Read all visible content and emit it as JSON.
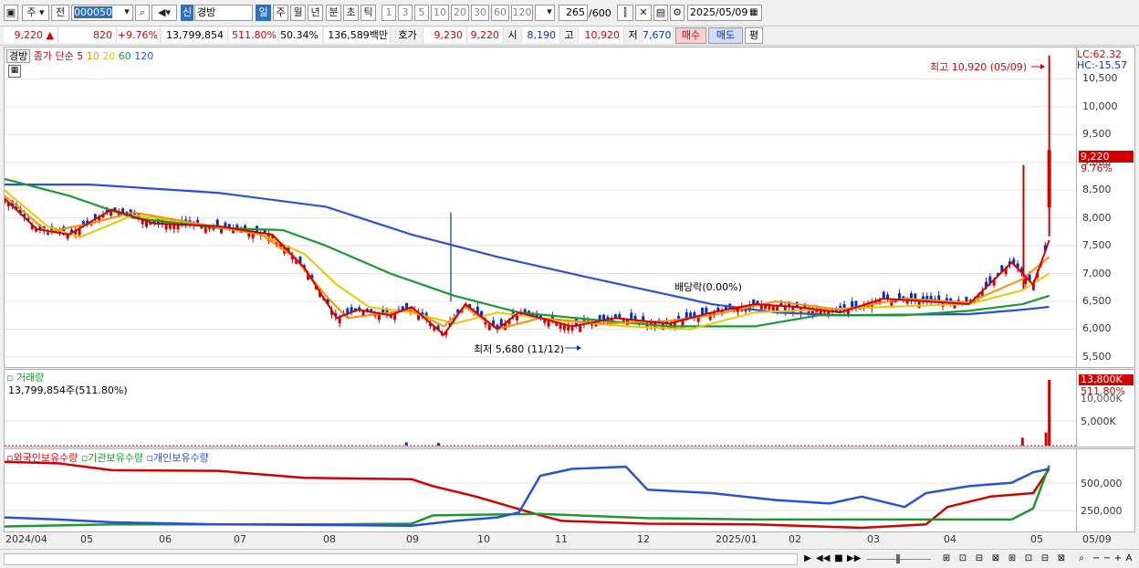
{
  "toolbar": {
    "market": "주",
    "prefix": "전",
    "code": "000050",
    "badge": "신",
    "name": "경방",
    "periods": [
      "일",
      "주",
      "월",
      "년",
      "분",
      "초",
      "틱"
    ],
    "active_period": "일",
    "intervals": [
      "1",
      "3",
      "5",
      "10",
      "20",
      "30",
      "60",
      "120"
    ],
    "count": "265",
    "total": "/600",
    "date": "2025/05/09"
  },
  "quote": {
    "price": "9,220",
    "arrow": "▲",
    "change": "820",
    "change_pct": "+9.76%",
    "volume": "13,799,854",
    "volume_pct": "511.80%",
    "turnover": "50.34%",
    "amount": "136,589백만",
    "bid_label": "호가",
    "bid1": "9,230",
    "bid2": "9,220",
    "open_label": "시",
    "open": "8,190",
    "high_label": "고",
    "high": "10,920",
    "low_label": "저",
    "low": "7,670",
    "buy": "매수",
    "sell": "매도",
    "avg": "평"
  },
  "price_pane": {
    "tag": "경방",
    "ma_label": "종가 단순",
    "ma_periods": [
      "5",
      "10",
      "20",
      "60",
      "120"
    ],
    "ma_colors": [
      "#d40000",
      "#ff8c00",
      "#e6c800",
      "#1a9a30",
      "#2850d8"
    ],
    "lc": "LC:62.32",
    "hc": "HC:-15.57",
    "high_note": "최고 10,920 (05/09)",
    "low_note": "최저 5,680 (11/12)",
    "dividend_note": "배당락(0.00%)",
    "y_ticks": [
      "10,500",
      "10,000",
      "9,500",
      "9,000",
      "8,500",
      "8,000",
      "7,500",
      "7,000",
      "6,500",
      "6,000",
      "5,500"
    ],
    "last_price": "9,220",
    "last_pct": "9.76%"
  },
  "volume_pane": {
    "title": "거래량",
    "value": "13,799,854주(511.80%)",
    "y_ticks": [
      "10,000K",
      "5,000K"
    ],
    "last_value": "13,800K",
    "last_pct": "511.80%"
  },
  "holding_pane": {
    "series": [
      "외국인보유수량",
      "기관보유수량",
      "개인보유수량"
    ],
    "colors": [
      "#d40000",
      "#1a9a30",
      "#2850d8"
    ],
    "y_ticks": [
      "500,000",
      "250,000"
    ]
  },
  "x_ticks": [
    "2024/04",
    "05",
    "06",
    "07",
    "08",
    "09",
    "10",
    "11",
    "12",
    "2025/01",
    "02",
    "03",
    "04",
    "05",
    "05/09"
  ],
  "chart_data": {
    "type": "candlestick",
    "price_range": [
      5400,
      10900
    ],
    "ma": {
      "ma120": [
        [
          0,
          8600
        ],
        [
          0.08,
          8600
        ],
        [
          0.2,
          8450
        ],
        [
          0.3,
          8200
        ],
        [
          0.38,
          7700
        ],
        [
          0.46,
          7300
        ],
        [
          0.54,
          6950
        ],
        [
          0.6,
          6700
        ],
        [
          0.66,
          6450
        ],
        [
          0.72,
          6300
        ],
        [
          0.78,
          6250
        ],
        [
          0.9,
          6270
        ],
        [
          0.95,
          6350
        ],
        [
          0.975,
          6400
        ]
      ],
      "ma60": [
        [
          0,
          8700
        ],
        [
          0.06,
          8400
        ],
        [
          0.12,
          8000
        ],
        [
          0.2,
          7820
        ],
        [
          0.26,
          7780
        ],
        [
          0.3,
          7500
        ],
        [
          0.36,
          7000
        ],
        [
          0.42,
          6600
        ],
        [
          0.48,
          6300
        ],
        [
          0.56,
          6150
        ],
        [
          0.62,
          6050
        ],
        [
          0.7,
          6050
        ],
        [
          0.76,
          6250
        ],
        [
          0.84,
          6250
        ],
        [
          0.9,
          6330
        ],
        [
          0.95,
          6450
        ],
        [
          0.975,
          6600
        ]
      ],
      "ma20": [
        [
          0,
          8500
        ],
        [
          0.04,
          7850
        ],
        [
          0.07,
          7650
        ],
        [
          0.12,
          8050
        ],
        [
          0.18,
          7900
        ],
        [
          0.24,
          7700
        ],
        [
          0.28,
          7350
        ],
        [
          0.31,
          6800
        ],
        [
          0.34,
          6400
        ],
        [
          0.38,
          6300
        ],
        [
          0.42,
          6100
        ],
        [
          0.46,
          6300
        ],
        [
          0.52,
          6150
        ],
        [
          0.58,
          6050
        ],
        [
          0.64,
          6000
        ],
        [
          0.7,
          6300
        ],
        [
          0.76,
          6350
        ],
        [
          0.82,
          6400
        ],
        [
          0.9,
          6450
        ],
        [
          0.95,
          6700
        ],
        [
          0.975,
          7000
        ]
      ],
      "ma10": [
        [
          0,
          8400
        ],
        [
          0.04,
          7750
        ],
        [
          0.08,
          7900
        ],
        [
          0.12,
          8100
        ],
        [
          0.18,
          7900
        ],
        [
          0.24,
          7700
        ],
        [
          0.27,
          7300
        ],
        [
          0.3,
          6600
        ],
        [
          0.32,
          6200
        ],
        [
          0.36,
          6300
        ],
        [
          0.38,
          6350
        ],
        [
          0.41,
          6050
        ],
        [
          0.43,
          6400
        ],
        [
          0.46,
          6000
        ],
        [
          0.5,
          6200
        ],
        [
          0.56,
          6100
        ],
        [
          0.62,
          6150
        ],
        [
          0.66,
          6250
        ],
        [
          0.72,
          6500
        ],
        [
          0.78,
          6350
        ],
        [
          0.84,
          6550
        ],
        [
          0.9,
          6480
        ],
        [
          0.95,
          6900
        ],
        [
          0.975,
          7300
        ]
      ],
      "ma5": [
        [
          0,
          8350
        ],
        [
          0.03,
          7800
        ],
        [
          0.06,
          7700
        ],
        [
          0.1,
          8150
        ],
        [
          0.14,
          7900
        ],
        [
          0.2,
          7850
        ],
        [
          0.25,
          7700
        ],
        [
          0.28,
          7100
        ],
        [
          0.31,
          6200
        ],
        [
          0.33,
          6350
        ],
        [
          0.36,
          6250
        ],
        [
          0.38,
          6400
        ],
        [
          0.41,
          5900
        ],
        [
          0.43,
          6450
        ],
        [
          0.46,
          6000
        ],
        [
          0.48,
          6300
        ],
        [
          0.53,
          6050
        ],
        [
          0.57,
          6200
        ],
        [
          0.62,
          6100
        ],
        [
          0.66,
          6300
        ],
        [
          0.7,
          6450
        ],
        [
          0.74,
          6400
        ],
        [
          0.78,
          6300
        ],
        [
          0.82,
          6550
        ],
        [
          0.86,
          6500
        ],
        [
          0.9,
          6450
        ],
        [
          0.94,
          7200
        ],
        [
          0.96,
          6800
        ],
        [
          0.975,
          7600
        ]
      ]
    },
    "volume_spikes": [
      [
        0.375,
        0.05
      ],
      [
        0.405,
        0.04
      ],
      [
        0.95,
        0.12
      ],
      [
        0.972,
        0.2
      ],
      [
        0.975,
        1.0
      ]
    ],
    "holdings": {
      "foreign": [
        [
          0,
          0.95
        ],
        [
          0.05,
          0.93
        ],
        [
          0.1,
          0.83
        ],
        [
          0.2,
          0.82
        ],
        [
          0.28,
          0.72
        ],
        [
          0.38,
          0.7
        ],
        [
          0.4,
          0.6
        ],
        [
          0.44,
          0.45
        ],
        [
          0.5,
          0.18
        ],
        [
          0.52,
          0.1
        ],
        [
          0.6,
          0.06
        ],
        [
          0.7,
          0.05
        ],
        [
          0.8,
          0.0
        ],
        [
          0.86,
          0.05
        ],
        [
          0.88,
          0.3
        ],
        [
          0.92,
          0.45
        ],
        [
          0.96,
          0.5
        ],
        [
          0.975,
          0.85
        ]
      ],
      "institution": [
        [
          0,
          0.02
        ],
        [
          0.1,
          0.05
        ],
        [
          0.3,
          0.05
        ],
        [
          0.38,
          0.06
        ],
        [
          0.4,
          0.18
        ],
        [
          0.5,
          0.2
        ],
        [
          0.6,
          0.14
        ],
        [
          0.7,
          0.12
        ],
        [
          0.85,
          0.12
        ],
        [
          0.94,
          0.12
        ],
        [
          0.96,
          0.28
        ],
        [
          0.975,
          0.9
        ]
      ],
      "individual": [
        [
          0,
          0.15
        ],
        [
          0.05,
          0.12
        ],
        [
          0.1,
          0.08
        ],
        [
          0.2,
          0.05
        ],
        [
          0.3,
          0.04
        ],
        [
          0.38,
          0.03
        ],
        [
          0.42,
          0.1
        ],
        [
          0.46,
          0.15
        ],
        [
          0.48,
          0.22
        ],
        [
          0.5,
          0.75
        ],
        [
          0.53,
          0.85
        ],
        [
          0.58,
          0.88
        ],
        [
          0.6,
          0.55
        ],
        [
          0.66,
          0.5
        ],
        [
          0.72,
          0.4
        ],
        [
          0.77,
          0.35
        ],
        [
          0.8,
          0.45
        ],
        [
          0.84,
          0.3
        ],
        [
          0.86,
          0.5
        ],
        [
          0.9,
          0.6
        ],
        [
          0.94,
          0.65
        ],
        [
          0.96,
          0.8
        ],
        [
          0.975,
          0.85
        ]
      ]
    }
  }
}
